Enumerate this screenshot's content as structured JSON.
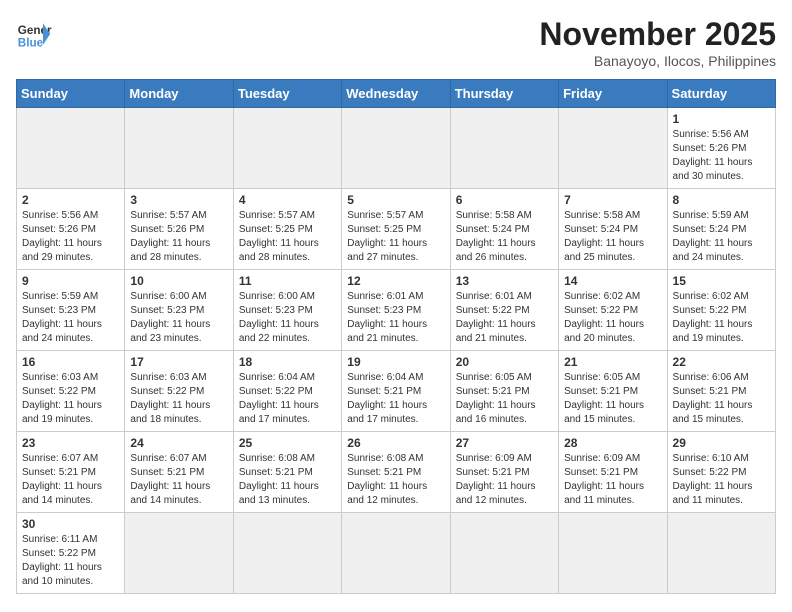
{
  "header": {
    "logo_text_regular": "General",
    "logo_text_blue": "Blue",
    "month_title": "November 2025",
    "location": "Banayoyo, Ilocos, Philippines"
  },
  "weekdays": [
    "Sunday",
    "Monday",
    "Tuesday",
    "Wednesday",
    "Thursday",
    "Friday",
    "Saturday"
  ],
  "weeks": [
    [
      {
        "day": "",
        "empty": true
      },
      {
        "day": "",
        "empty": true
      },
      {
        "day": "",
        "empty": true
      },
      {
        "day": "",
        "empty": true
      },
      {
        "day": "",
        "empty": true
      },
      {
        "day": "",
        "empty": true
      },
      {
        "day": "1",
        "sunrise": "5:56 AM",
        "sunset": "5:26 PM",
        "daylight": "11 hours and 30 minutes."
      }
    ],
    [
      {
        "day": "2",
        "sunrise": "5:56 AM",
        "sunset": "5:26 PM",
        "daylight": "11 hours and 29 minutes."
      },
      {
        "day": "3",
        "sunrise": "5:57 AM",
        "sunset": "5:26 PM",
        "daylight": "11 hours and 28 minutes."
      },
      {
        "day": "4",
        "sunrise": "5:57 AM",
        "sunset": "5:25 PM",
        "daylight": "11 hours and 28 minutes."
      },
      {
        "day": "5",
        "sunrise": "5:57 AM",
        "sunset": "5:25 PM",
        "daylight": "11 hours and 27 minutes."
      },
      {
        "day": "6",
        "sunrise": "5:58 AM",
        "sunset": "5:24 PM",
        "daylight": "11 hours and 26 minutes."
      },
      {
        "day": "7",
        "sunrise": "5:58 AM",
        "sunset": "5:24 PM",
        "daylight": "11 hours and 25 minutes."
      },
      {
        "day": "8",
        "sunrise": "5:59 AM",
        "sunset": "5:24 PM",
        "daylight": "11 hours and 24 minutes."
      }
    ],
    [
      {
        "day": "9",
        "sunrise": "5:59 AM",
        "sunset": "5:23 PM",
        "daylight": "11 hours and 24 minutes."
      },
      {
        "day": "10",
        "sunrise": "6:00 AM",
        "sunset": "5:23 PM",
        "daylight": "11 hours and 23 minutes."
      },
      {
        "day": "11",
        "sunrise": "6:00 AM",
        "sunset": "5:23 PM",
        "daylight": "11 hours and 22 minutes."
      },
      {
        "day": "12",
        "sunrise": "6:01 AM",
        "sunset": "5:23 PM",
        "daylight": "11 hours and 21 minutes."
      },
      {
        "day": "13",
        "sunrise": "6:01 AM",
        "sunset": "5:22 PM",
        "daylight": "11 hours and 21 minutes."
      },
      {
        "day": "14",
        "sunrise": "6:02 AM",
        "sunset": "5:22 PM",
        "daylight": "11 hours and 20 minutes."
      },
      {
        "day": "15",
        "sunrise": "6:02 AM",
        "sunset": "5:22 PM",
        "daylight": "11 hours and 19 minutes."
      }
    ],
    [
      {
        "day": "16",
        "sunrise": "6:03 AM",
        "sunset": "5:22 PM",
        "daylight": "11 hours and 19 minutes."
      },
      {
        "day": "17",
        "sunrise": "6:03 AM",
        "sunset": "5:22 PM",
        "daylight": "11 hours and 18 minutes."
      },
      {
        "day": "18",
        "sunrise": "6:04 AM",
        "sunset": "5:22 PM",
        "daylight": "11 hours and 17 minutes."
      },
      {
        "day": "19",
        "sunrise": "6:04 AM",
        "sunset": "5:21 PM",
        "daylight": "11 hours and 17 minutes."
      },
      {
        "day": "20",
        "sunrise": "6:05 AM",
        "sunset": "5:21 PM",
        "daylight": "11 hours and 16 minutes."
      },
      {
        "day": "21",
        "sunrise": "6:05 AM",
        "sunset": "5:21 PM",
        "daylight": "11 hours and 15 minutes."
      },
      {
        "day": "22",
        "sunrise": "6:06 AM",
        "sunset": "5:21 PM",
        "daylight": "11 hours and 15 minutes."
      }
    ],
    [
      {
        "day": "23",
        "sunrise": "6:07 AM",
        "sunset": "5:21 PM",
        "daylight": "11 hours and 14 minutes."
      },
      {
        "day": "24",
        "sunrise": "6:07 AM",
        "sunset": "5:21 PM",
        "daylight": "11 hours and 14 minutes."
      },
      {
        "day": "25",
        "sunrise": "6:08 AM",
        "sunset": "5:21 PM",
        "daylight": "11 hours and 13 minutes."
      },
      {
        "day": "26",
        "sunrise": "6:08 AM",
        "sunset": "5:21 PM",
        "daylight": "11 hours and 12 minutes."
      },
      {
        "day": "27",
        "sunrise": "6:09 AM",
        "sunset": "5:21 PM",
        "daylight": "11 hours and 12 minutes."
      },
      {
        "day": "28",
        "sunrise": "6:09 AM",
        "sunset": "5:21 PM",
        "daylight": "11 hours and 11 minutes."
      },
      {
        "day": "29",
        "sunrise": "6:10 AM",
        "sunset": "5:22 PM",
        "daylight": "11 hours and 11 minutes."
      }
    ],
    [
      {
        "day": "30",
        "sunrise": "6:11 AM",
        "sunset": "5:22 PM",
        "daylight": "11 hours and 10 minutes."
      },
      {
        "day": "",
        "empty": true
      },
      {
        "day": "",
        "empty": true
      },
      {
        "day": "",
        "empty": true
      },
      {
        "day": "",
        "empty": true
      },
      {
        "day": "",
        "empty": true
      },
      {
        "day": "",
        "empty": true
      }
    ]
  ]
}
